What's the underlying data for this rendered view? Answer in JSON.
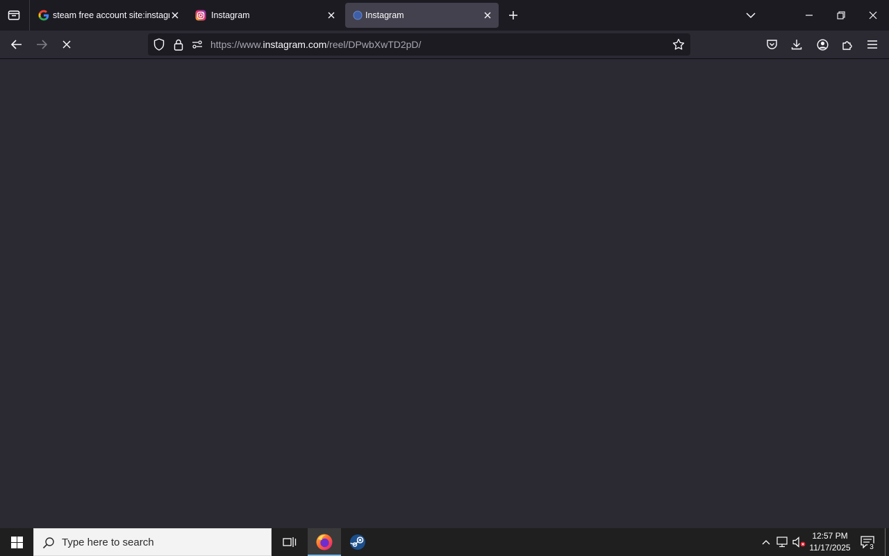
{
  "browser": {
    "tabs": [
      {
        "title": "steam free account site:instagra",
        "favicon": "google-g-icon"
      },
      {
        "title": "Instagram",
        "favicon": "instagram-icon"
      },
      {
        "title": "Instagram",
        "favicon": "loading-globe-icon",
        "active": true
      }
    ],
    "url": {
      "prefix": "https://www.",
      "host": "instagram.com",
      "path": "/reel/DPwbXwTD2pD/"
    },
    "accent_colors": {
      "tabstrip_bg": "#1c1b22",
      "toolbar_bg": "#2b2a33",
      "active_tab_bg": "#42414d"
    }
  },
  "taskbar": {
    "search_placeholder": "Type here to search",
    "time": "12:57 PM",
    "date": "11/17/2025",
    "notification_count": "3"
  }
}
